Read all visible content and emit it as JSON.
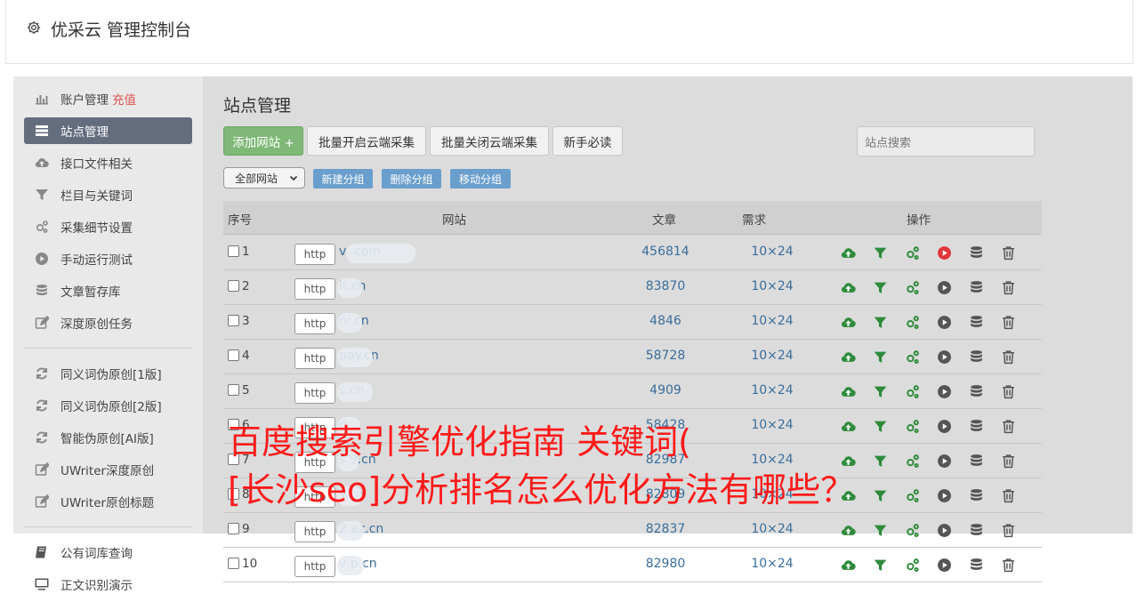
{
  "app": {
    "title": "优采云 管理控制台"
  },
  "sidebar": {
    "items": [
      {
        "label": "账户管理",
        "highlight": "充值",
        "icon": "bar-chart-icon"
      },
      {
        "label": "站点管理",
        "icon": "list-icon",
        "active": true
      },
      {
        "label": "接口文件相关",
        "icon": "cloud-upload-icon"
      },
      {
        "label": "栏目与关键词",
        "icon": "filter-icon"
      },
      {
        "label": "采集细节设置",
        "icon": "gears-icon"
      },
      {
        "label": "手动运行测试",
        "icon": "play-icon"
      },
      {
        "label": "文章暂存库",
        "icon": "database-icon"
      },
      {
        "label": "深度原创任务",
        "icon": "edit-icon"
      },
      {
        "label": "同义词伪原创[1版]",
        "icon": "refresh-icon"
      },
      {
        "label": "同义词伪原创[2版]",
        "icon": "refresh-icon"
      },
      {
        "label": "智能伪原创[AI版]",
        "icon": "refresh-icon"
      },
      {
        "label": "UWriter深度原创",
        "icon": "edit-icon"
      },
      {
        "label": "UWriter原创标题",
        "icon": "edit-icon"
      },
      {
        "label": "公有词库查询",
        "icon": "book-icon"
      },
      {
        "label": "正文识别演示",
        "icon": "monitor-icon"
      }
    ]
  },
  "main": {
    "title": "站点管理",
    "toolbar": {
      "add_label": "添加网站 +",
      "batch_on_label": "批量开启云端采集",
      "batch_off_label": "批量关闭云端采集",
      "guide_label": "新手必读",
      "search_placeholder": "站点搜索"
    },
    "filter": {
      "group_select": "全部网站",
      "new_group": "新建分组",
      "delete_group": "删除分组",
      "move_group": "移动分组"
    },
    "table": {
      "headers": [
        "序号",
        "网站",
        "文章",
        "需求",
        "操作"
      ],
      "rows": [
        {
          "num": "1",
          "protocol": "http",
          "site": "v .com",
          "articles": "456814",
          "need": "10×24",
          "running": true
        },
        {
          "num": "2",
          "protocol": "http",
          "site": "lt.cn",
          "articles": "83870",
          "need": "10×24",
          "running": false
        },
        {
          "num": "3",
          "protocol": "http",
          "site": "ni.cn",
          "articles": "4846",
          "need": "10×24",
          "running": false
        },
        {
          "num": "4",
          "protocol": "http",
          "site": "pay.cn",
          "articles": "58728",
          "need": "10×24",
          "running": false
        },
        {
          "num": "5",
          "protocol": "http",
          "site": "s.cn",
          "articles": "4909",
          "need": "10×24",
          "running": false
        },
        {
          "num": "6",
          "protocol": "http",
          "site": "n",
          "articles": "58428",
          "need": "10×24",
          "running": false
        },
        {
          "num": "7",
          "protocol": "http",
          "site": "s 9.cn",
          "articles": "82987",
          "need": "10×24",
          "running": false
        },
        {
          "num": "8",
          "protocol": "http",
          "site": "y.cn",
          "articles": "82809",
          "need": "10×24",
          "running": false
        },
        {
          "num": "9",
          "protocol": "http",
          "site": "2 az.cn",
          "articles": "82837",
          "need": "10×24",
          "running": false
        },
        {
          "num": "10",
          "protocol": "http",
          "site": "v p.cn",
          "articles": "82980",
          "need": "10×24",
          "running": false
        }
      ]
    }
  },
  "overlay": {
    "line1": "百度搜索引擎优化指南 关键词(",
    "line2": "[长沙seo]分析排名怎么优化方法有哪些？"
  },
  "colors": {
    "accent_green": "#7fb877",
    "accent_blue": "#6a9fcd",
    "link_blue": "#3a6d9c",
    "sidebar_active": "#646d7e",
    "overlay_red": "#ff1a1a",
    "run_red": "#e0363a"
  }
}
